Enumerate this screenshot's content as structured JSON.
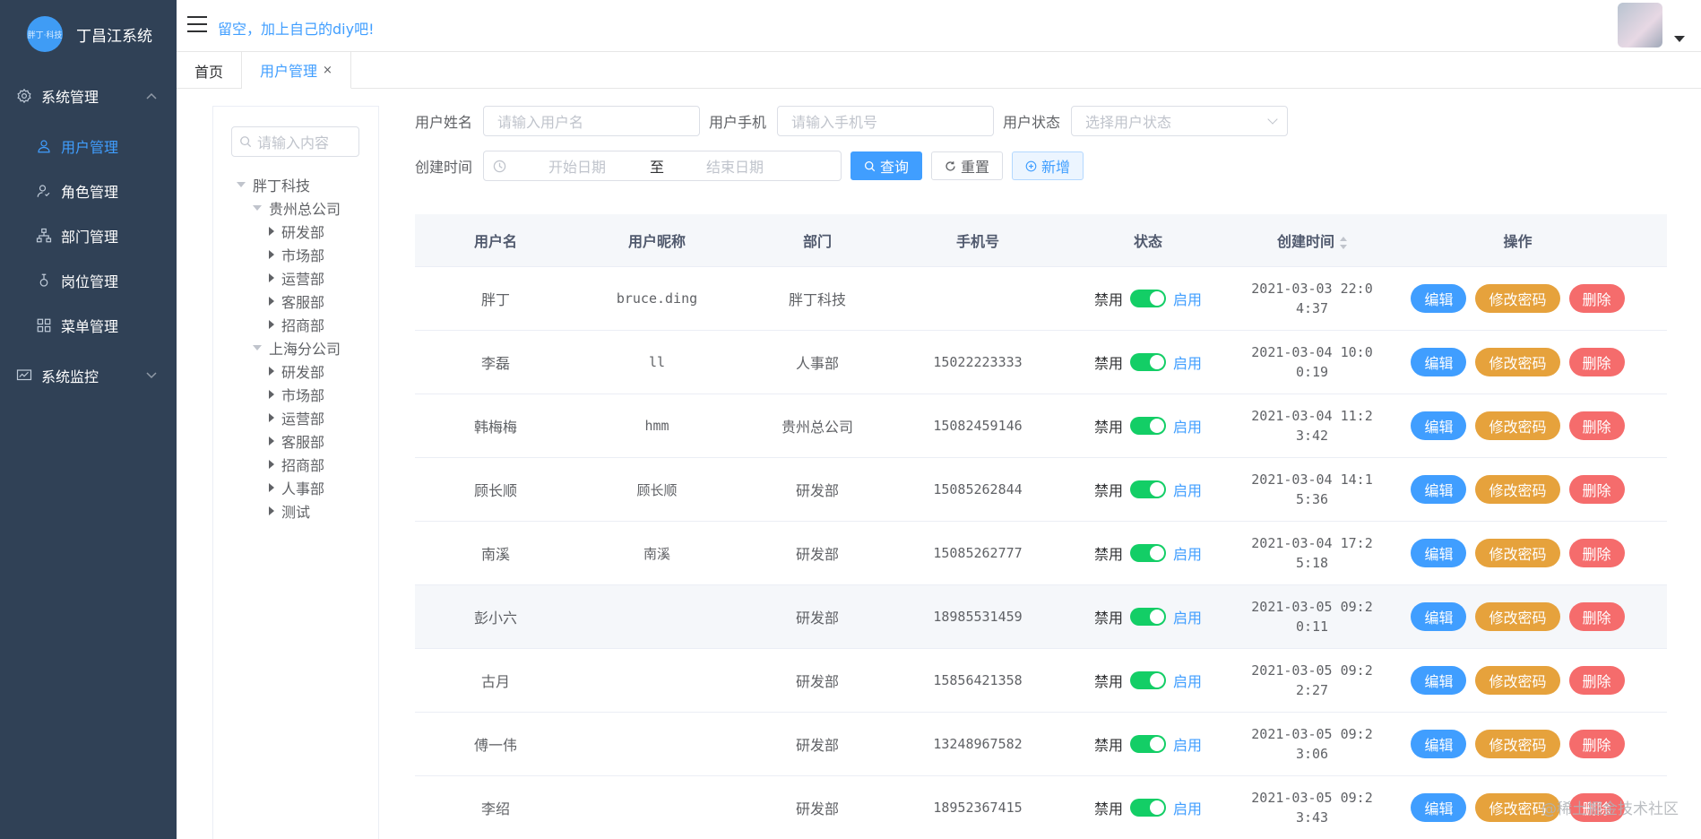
{
  "app": {
    "logo_text": "胖丁·科技",
    "title": "丁昌江系统"
  },
  "sidebar": {
    "groups": [
      {
        "label": "系统管理",
        "expanded": true,
        "items": [
          {
            "label": "用户管理",
            "icon": "user-icon",
            "active": true
          },
          {
            "label": "角色管理",
            "icon": "role-icon",
            "active": false
          },
          {
            "label": "部门管理",
            "icon": "tree-icon",
            "active": false
          },
          {
            "label": "岗位管理",
            "icon": "post-icon",
            "active": false
          },
          {
            "label": "菜单管理",
            "icon": "grid-icon",
            "active": false
          }
        ]
      },
      {
        "label": "系统监控",
        "expanded": false,
        "items": []
      }
    ]
  },
  "header": {
    "message": "留空，加上自己的diy吧!"
  },
  "tabs": [
    {
      "label": "首页",
      "active": false,
      "closable": false
    },
    {
      "label": "用户管理",
      "active": true,
      "closable": true,
      "close": "×"
    }
  ],
  "tree": {
    "search_placeholder": "请输入内容",
    "nodes": [
      {
        "label": "胖丁科技",
        "level": 0,
        "expanded": true
      },
      {
        "label": "贵州总公司",
        "level": 1,
        "expanded": true
      },
      {
        "label": "研发部",
        "level": 2
      },
      {
        "label": "市场部",
        "level": 2
      },
      {
        "label": "运营部",
        "level": 2
      },
      {
        "label": "客服部",
        "level": 2
      },
      {
        "label": "招商部",
        "level": 2
      },
      {
        "label": "上海分公司",
        "level": 1,
        "expanded": true
      },
      {
        "label": "研发部",
        "level": 2
      },
      {
        "label": "市场部",
        "level": 2
      },
      {
        "label": "运营部",
        "level": 2
      },
      {
        "label": "客服部",
        "level": 2
      },
      {
        "label": "招商部",
        "level": 2
      },
      {
        "label": "人事部",
        "level": 2
      },
      {
        "label": "测试",
        "level": 2
      }
    ]
  },
  "form": {
    "username_label": "用户姓名",
    "username_placeholder": "请输入用户名",
    "phone_label": "用户手机",
    "phone_placeholder": "请输入手机号",
    "status_label": "用户状态",
    "status_placeholder": "选择用户状态",
    "created_label": "创建时间",
    "start_placeholder": "开始日期",
    "range_sep": "至",
    "end_placeholder": "结束日期",
    "query_btn": "查询",
    "reset_btn": "重置",
    "add_btn": "新增"
  },
  "table": {
    "headers": [
      "用户名",
      "用户昵称",
      "部门",
      "手机号",
      "状态",
      "创建时间",
      "操作"
    ],
    "status_off": "禁用",
    "status_on": "启用",
    "actions": {
      "edit": "编辑",
      "password": "修改密码",
      "delete": "删除"
    },
    "rows": [
      {
        "username": "胖丁",
        "nickname": "bruce.ding",
        "dept": "胖丁科技",
        "phone": "",
        "enabled": true,
        "created": "2021-03-03 22:04:37"
      },
      {
        "username": "李磊",
        "nickname": "ll",
        "dept": "人事部",
        "phone": "15022223333",
        "enabled": true,
        "created": "2021-03-04 10:00:19"
      },
      {
        "username": "韩梅梅",
        "nickname": "hmm",
        "dept": "贵州总公司",
        "phone": "15082459146",
        "enabled": true,
        "created": "2021-03-04 11:23:42"
      },
      {
        "username": "顾长顺",
        "nickname": "顾长顺",
        "dept": "研发部",
        "phone": "15085262844",
        "enabled": true,
        "created": "2021-03-04 14:15:36"
      },
      {
        "username": "南溪",
        "nickname": "南溪",
        "dept": "研发部",
        "phone": "15085262777",
        "enabled": true,
        "created": "2021-03-04 17:25:18"
      },
      {
        "username": "彭小六",
        "nickname": "",
        "dept": "研发部",
        "phone": "18985531459",
        "enabled": true,
        "created": "2021-03-05 09:20:11"
      },
      {
        "username": "古月",
        "nickname": "",
        "dept": "研发部",
        "phone": "15856421358",
        "enabled": true,
        "created": "2021-03-05 09:22:27"
      },
      {
        "username": "傅一伟",
        "nickname": "",
        "dept": "研发部",
        "phone": "13248967582",
        "enabled": true,
        "created": "2021-03-05 09:23:06"
      },
      {
        "username": "李绍",
        "nickname": "",
        "dept": "研发部",
        "phone": "18952367415",
        "enabled": true,
        "created": "2021-03-05 09:23:43"
      }
    ]
  },
  "watermark": "@稀土掘金技术社区",
  "colors": {
    "sidebar_bg": "#304156",
    "primary": "#409eff",
    "warning": "#e6a23c",
    "danger": "#f56c6c",
    "switch_on": "#13ce66"
  }
}
